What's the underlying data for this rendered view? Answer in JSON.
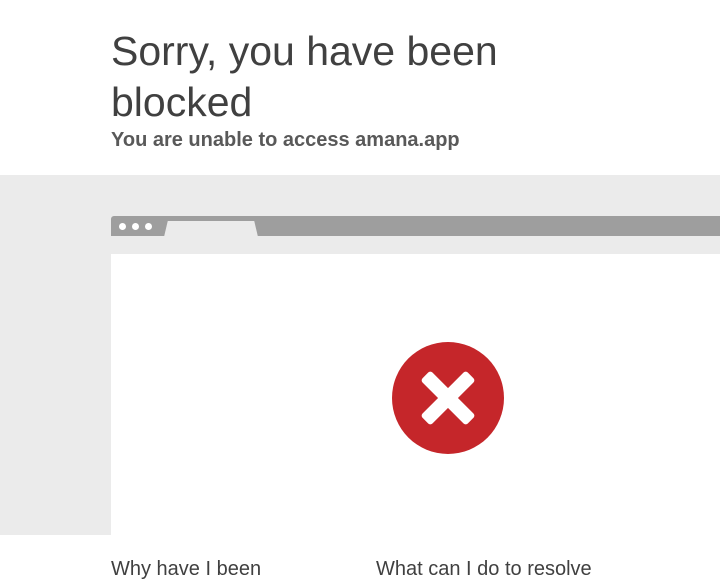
{
  "header": {
    "title": "Sorry, you have been blocked",
    "subtitle": "You are unable to access amana.app"
  },
  "browser_illustration": {
    "icon": "error-x-icon",
    "icon_color": "#c5262a"
  },
  "sections": {
    "why_heading": "Why have I been",
    "resolve_heading": "What can I do to resolve"
  },
  "colors": {
    "background": "#ffffff",
    "band": "#ebebeb",
    "browser_bar": "#9e9e9e",
    "text": "#404040"
  }
}
